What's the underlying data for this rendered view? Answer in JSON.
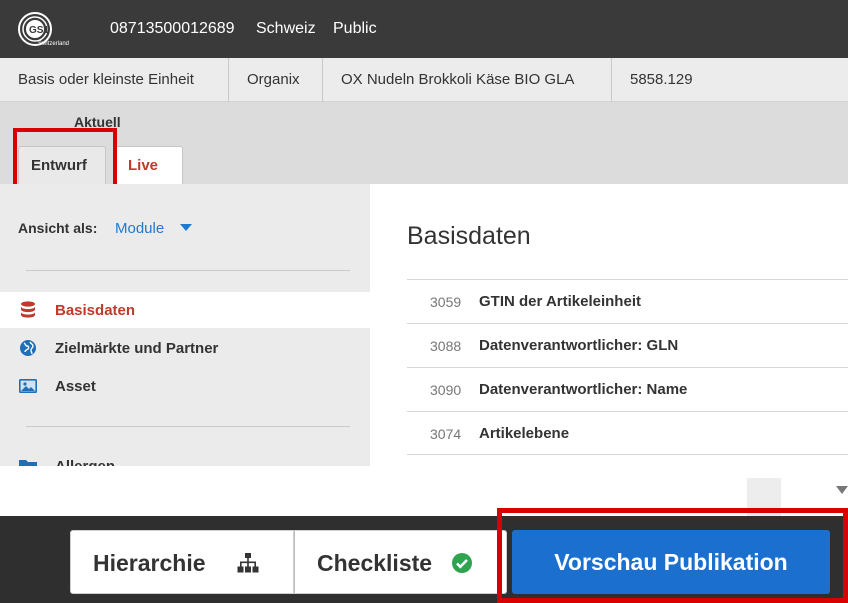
{
  "topbar": {
    "logo_text": "GS1",
    "logo_subtext": "Switzerland",
    "gtin": "08713500012689",
    "country": "Schweiz",
    "visibility": "Public"
  },
  "infobar": {
    "cells": [
      "Basis oder kleinste Einheit",
      "Organix",
      "OX Nudeln Brokkoli Käse BIO GLA",
      "5858.129"
    ]
  },
  "versions": {
    "label": "Aktuell",
    "tabs": [
      {
        "label": "Entwurf",
        "selected": false
      },
      {
        "label": "Live",
        "selected": true
      }
    ]
  },
  "sidebar": {
    "view_as_label": "Ansicht als:",
    "view_as_value": "Module",
    "items": [
      {
        "label": "Basisdaten",
        "icon": "database-icon",
        "active": true
      },
      {
        "label": "Zielmärkte und Partner",
        "icon": "globe-icon",
        "active": false
      },
      {
        "label": "Asset",
        "icon": "image-icon",
        "active": false
      },
      {
        "label": "Allergen",
        "icon": "folder-icon",
        "active": false
      }
    ]
  },
  "main": {
    "title": "Basisdaten",
    "fields": [
      {
        "id": "3059",
        "name": "GTIN der Artikeleinheit"
      },
      {
        "id": "3088",
        "name": "Datenverantwortlicher: GLN"
      },
      {
        "id": "3090",
        "name": "Datenverantwortlicher: Name"
      },
      {
        "id": "3074",
        "name": "Artikelebene"
      }
    ]
  },
  "actions": {
    "hierarchy_label": "Hierarchie",
    "checklist_label": "Checkliste",
    "preview_label": "Vorschau Publikation"
  },
  "colors": {
    "accent_red": "#c0392b",
    "link_blue": "#1f7ad1",
    "primary_button": "#1a6fcf",
    "highlight": "#d90000",
    "check_green": "#2ea44f"
  }
}
